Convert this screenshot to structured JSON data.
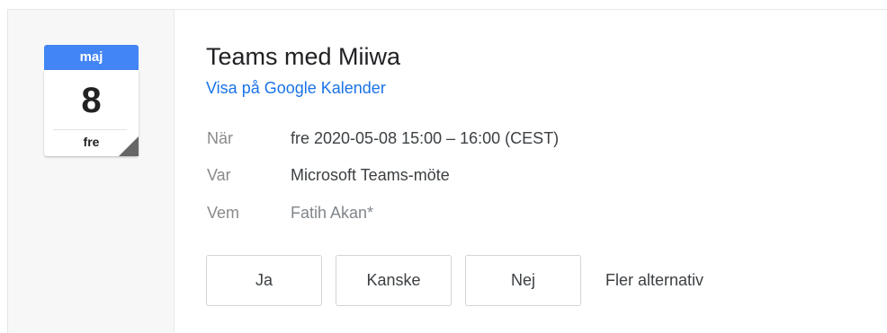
{
  "calendar": {
    "month": "maj",
    "day": "8",
    "weekday": "fre",
    "accent_color": "#4285f4"
  },
  "event": {
    "title": "Teams med Miiwa",
    "view_link": "Visa på Google Kalender"
  },
  "details": {
    "when": {
      "label": "När",
      "value": "fre 2020-05-08 15:00 – 16:00 (CEST)"
    },
    "where": {
      "label": "Var",
      "value": "Microsoft Teams-möte"
    },
    "who": {
      "label": "Vem",
      "value": "Fatih Akan*"
    }
  },
  "rsvp": {
    "yes": "Ja",
    "maybe": "Kanske",
    "no": "Nej",
    "more": "Fler alternativ"
  },
  "colors": {
    "link": "#1a73e8"
  }
}
